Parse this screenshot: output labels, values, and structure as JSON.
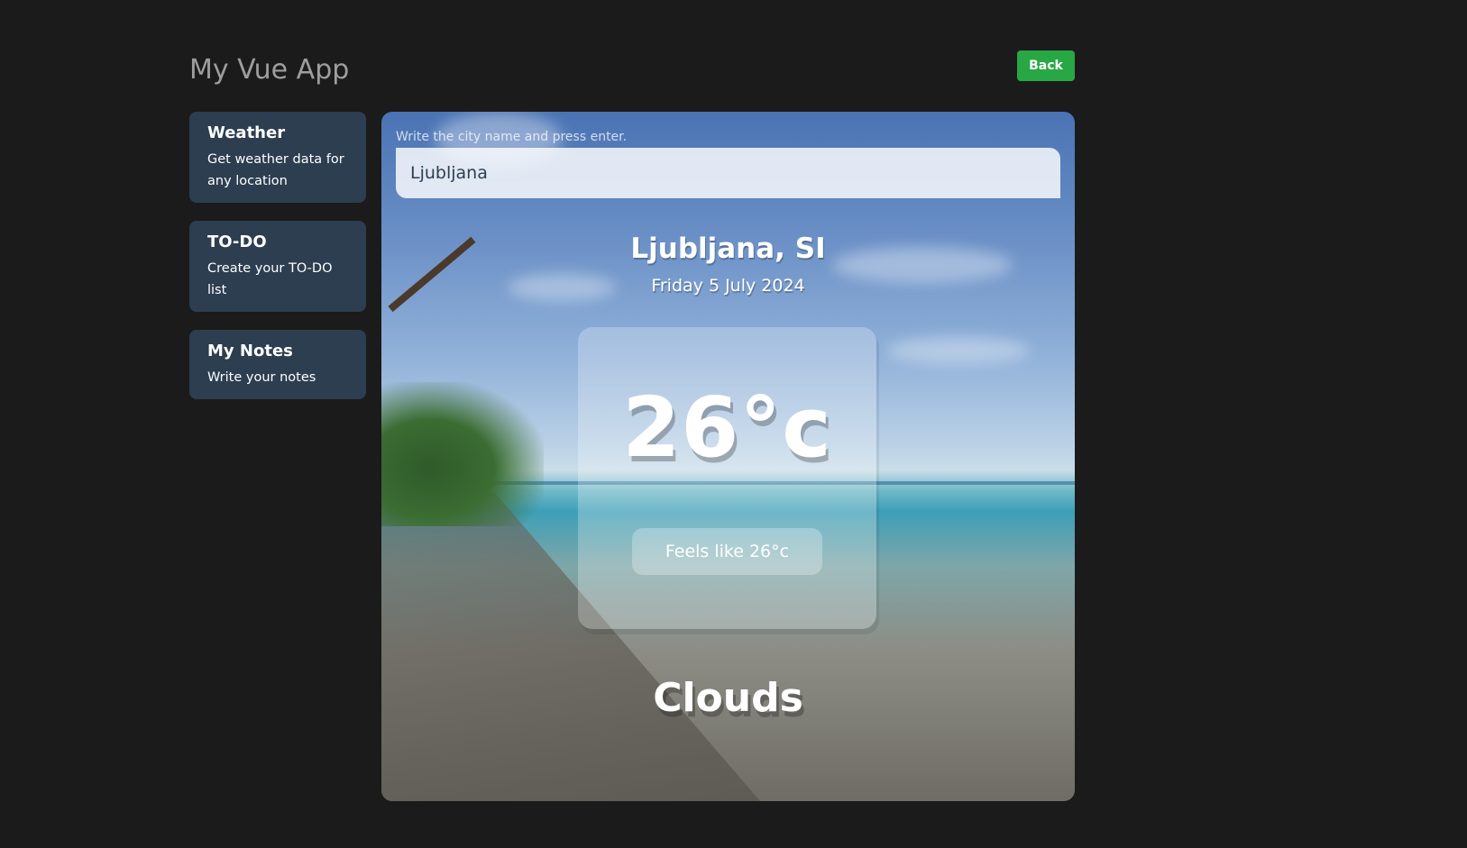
{
  "app": {
    "title": "My Vue App",
    "back_label": "Back"
  },
  "sidebar": {
    "items": [
      {
        "title": "Weather",
        "description": "Get weather data for any location"
      },
      {
        "title": "TO-DO",
        "description": "Create your TO-DO list"
      },
      {
        "title": "My Notes",
        "description": "Write your notes"
      }
    ]
  },
  "weather": {
    "input_label": "Write the city name and press enter.",
    "city_value": "Ljubljana",
    "location": "Ljubljana, SI",
    "date": "Friday 5 July 2024",
    "temperature": "26°c",
    "feels_like": "Feels like 26°c",
    "condition": "Clouds",
    "background": "beach-scene"
  },
  "colors": {
    "page_background": "#1b1b1b",
    "card_background": "#2c3e50",
    "back_button": "#28a745",
    "title_text": "#9e9e9e"
  }
}
